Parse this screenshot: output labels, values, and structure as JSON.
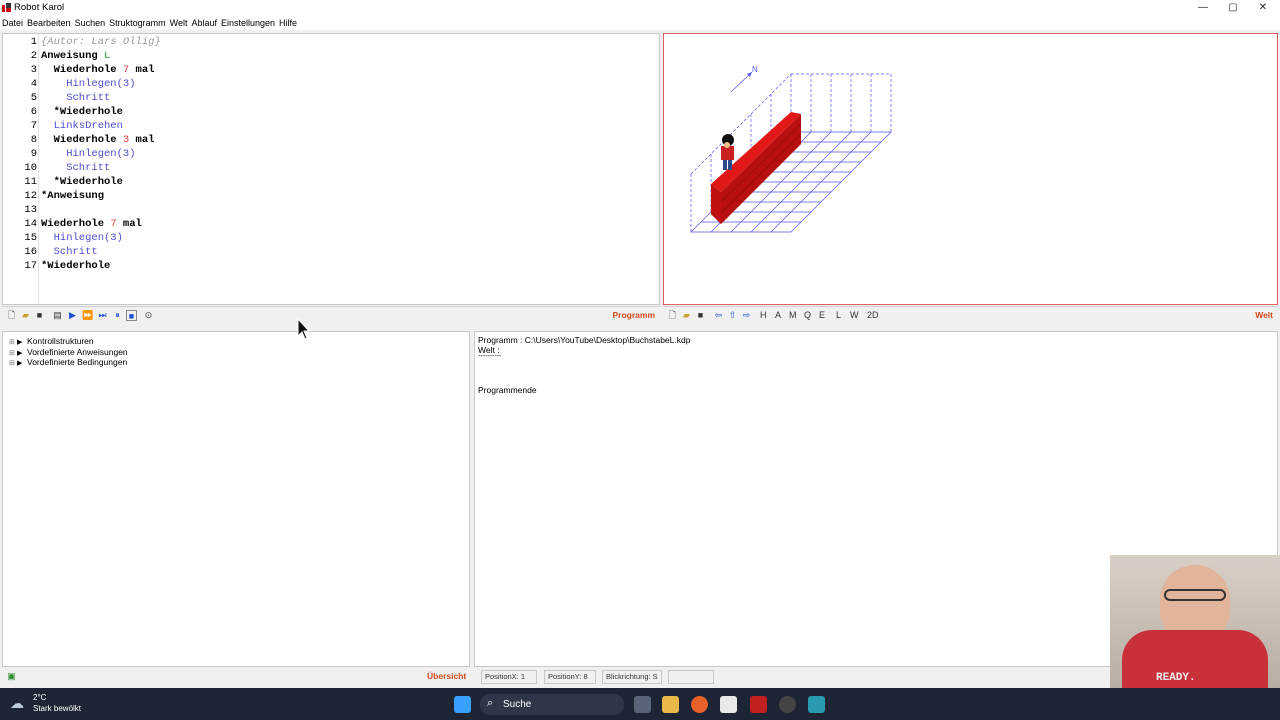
{
  "window": {
    "title": "Robot Karol",
    "min": "—",
    "max": "▢",
    "close": "✕"
  },
  "menu": [
    "Datei",
    "Bearbeiten",
    "Suchen",
    "Struktogramm",
    "Welt",
    "Ablauf",
    "Einstellungen",
    "Hilfe"
  ],
  "editor": {
    "lines": [
      {
        "n": "1",
        "segs": [
          {
            "t": "{Autor: Lars Ollig}",
            "c": "cmt"
          }
        ]
      },
      {
        "n": "2",
        "segs": [
          {
            "t": "Anweisung ",
            "c": "kw"
          },
          {
            "t": "L",
            "c": "green"
          }
        ]
      },
      {
        "n": "3",
        "segs": [
          {
            "t": "  Wiederhole ",
            "c": "kw"
          },
          {
            "t": "7",
            "c": "red"
          },
          {
            "t": " mal",
            "c": "kw"
          }
        ]
      },
      {
        "n": "4",
        "segs": [
          {
            "t": "    Hinlegen(3)",
            "c": "blue"
          }
        ]
      },
      {
        "n": "5",
        "segs": [
          {
            "t": "    Schritt",
            "c": "blue"
          }
        ]
      },
      {
        "n": "6",
        "segs": [
          {
            "t": "  *Wiederhole",
            "c": "kw"
          }
        ]
      },
      {
        "n": "7",
        "segs": [
          {
            "t": "  LinksDrehen",
            "c": "blue"
          }
        ]
      },
      {
        "n": "8",
        "segs": [
          {
            "t": "  Wiederhole ",
            "c": "kw"
          },
          {
            "t": "3",
            "c": "red"
          },
          {
            "t": " mal",
            "c": "kw"
          }
        ]
      },
      {
        "n": "9",
        "segs": [
          {
            "t": "    Hinlegen(3)",
            "c": "blue"
          }
        ]
      },
      {
        "n": "10",
        "segs": [
          {
            "t": "    Schritt",
            "c": "blue"
          }
        ]
      },
      {
        "n": "11",
        "segs": [
          {
            "t": "  *Wiederhole",
            "c": "kw"
          }
        ]
      },
      {
        "n": "12",
        "segs": [
          {
            "t": "*Anweisung",
            "c": "kw"
          }
        ]
      },
      {
        "n": "13",
        "segs": []
      },
      {
        "n": "14",
        "segs": [
          {
            "t": "Wiederhole ",
            "c": "kw"
          },
          {
            "t": "7",
            "c": "red"
          },
          {
            "t": " mal",
            "c": "kw"
          }
        ]
      },
      {
        "n": "15",
        "segs": [
          {
            "t": "  Hinlegen(3)",
            "c": "blue"
          }
        ]
      },
      {
        "n": "16",
        "segs": [
          {
            "t": "  Schritt",
            "c": "blue"
          }
        ]
      },
      {
        "n": "17",
        "segs": [
          {
            "t": "*Wiederhole",
            "c": "kw"
          }
        ]
      }
    ]
  },
  "editor_toolbar": {
    "label": "Programm"
  },
  "world_toolbar": {
    "letters": [
      "H",
      "A",
      "M",
      "Q",
      "E",
      "L",
      "W",
      "2D"
    ],
    "label": "Welt"
  },
  "world": {
    "compass": "N"
  },
  "tree": {
    "items": [
      "Kontrollstrukturen",
      "Vordefinierte Anweisungen",
      "Vordefinierte Bedingungen"
    ],
    "footer_label": "Übersicht"
  },
  "output": {
    "lines": [
      "Programm : C:\\Users\\YouTube\\Desktop\\BuchstabeL.kdp",
      "Welt :",
      "----------",
      "",
      "",
      "Programmende"
    ]
  },
  "status": {
    "posx": "PositionX: 1",
    "posy": "PositionY: 8",
    "dir": "Blickrichtung: S"
  },
  "taskbar": {
    "temp": "2°C",
    "weather": "Stark bewölkt",
    "search": "Suche"
  },
  "webcam": {
    "shirt_text": "READY."
  },
  "colors": {
    "accent": "#d24a1c",
    "world_border": "#e06060",
    "wall": "#b01010",
    "grid": "#5555ee"
  }
}
